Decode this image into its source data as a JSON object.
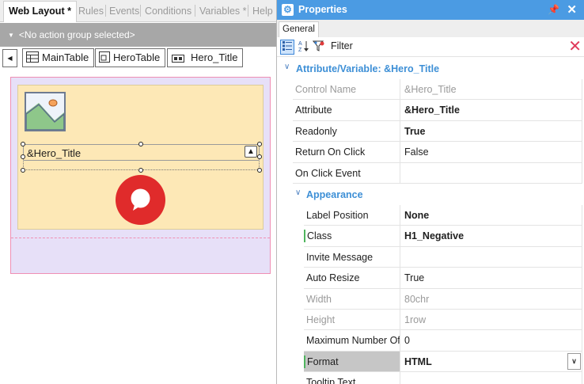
{
  "designer": {
    "tabs": [
      {
        "label": "Web Layout *"
      },
      {
        "label": "Rules"
      },
      {
        "label": "Events"
      },
      {
        "label": "Conditions"
      },
      {
        "label": "Variables *"
      },
      {
        "label": "Help"
      }
    ],
    "action_group": "<No action group selected>",
    "breadcrumbs": [
      "MainTable",
      "HeroTable",
      "Hero_Title"
    ],
    "title_control_text": "&Hero_Title"
  },
  "properties": {
    "title": "Properties",
    "pin_icon": "pin-icon",
    "tab": "General",
    "filter_label": "Filter",
    "filter_value": "",
    "category_main": "Attribute/Variable: &Hero_Title",
    "category_appearance": "Appearance",
    "rows_main": [
      {
        "name": "Control Name",
        "value": "&Hero_Title"
      },
      {
        "name": "Attribute",
        "value": "&Hero_Title"
      },
      {
        "name": "Readonly",
        "value": "True"
      },
      {
        "name": "Return On Click",
        "value": "False"
      },
      {
        "name": "On Click Event",
        "value": ""
      }
    ],
    "rows_appearance": [
      {
        "name": "Label Position",
        "value": "None"
      },
      {
        "name": "Class",
        "value": "H1_Negative"
      },
      {
        "name": "Invite Message",
        "value": ""
      },
      {
        "name": "Auto Resize",
        "value": "True"
      },
      {
        "name": "Width",
        "value": "80chr"
      },
      {
        "name": "Height",
        "value": "1row"
      },
      {
        "name": "Maximum Number Of",
        "value": "0"
      },
      {
        "name": "Format",
        "value": "HTML"
      },
      {
        "name": "Tooltip Text",
        "value": ""
      }
    ]
  },
  "colors": {
    "title_bar": "#4b9be3",
    "hero_background": "#fde8b6",
    "main_table_background": "#e7e0f8",
    "chat_circle": "#e02b2b"
  }
}
